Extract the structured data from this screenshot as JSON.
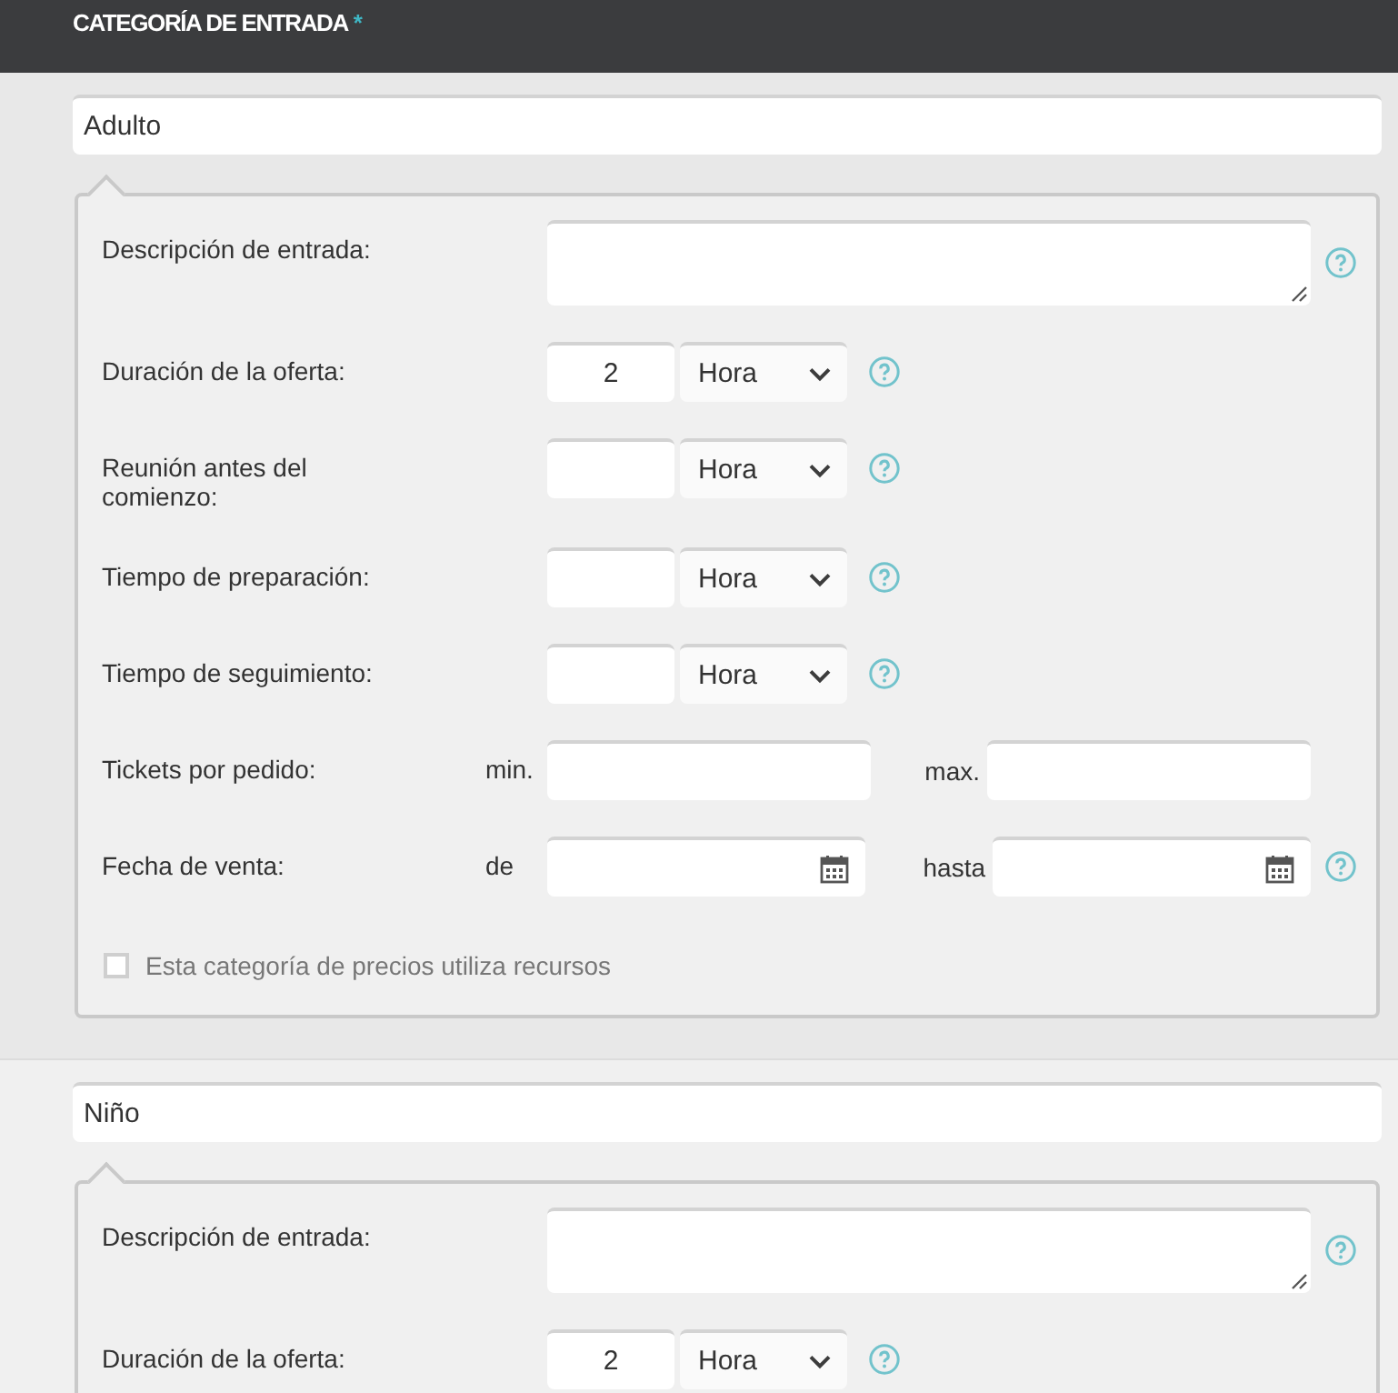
{
  "header": {
    "title": "CATEGORÍA DE ENTRADA",
    "required_mark": "*"
  },
  "categories": [
    {
      "name": "Adulto",
      "fields": [
        {
          "kind": "textarea",
          "label": "Descripción de entrada:",
          "help": true
        },
        {
          "kind": "duration",
          "label": "Duración de la oferta:",
          "value": "2",
          "unit": "Hora",
          "help": true
        },
        {
          "kind": "duration",
          "label": "Reunión antes del comienzo:",
          "unit": "Hora",
          "help": true
        },
        {
          "kind": "duration",
          "label": "Tiempo de preparación:",
          "unit": "Hora",
          "help": true
        },
        {
          "kind": "duration",
          "label": "Tiempo de seguimiento:",
          "unit": "Hora",
          "help": true
        },
        {
          "kind": "range",
          "label": "Tickets por pedido:",
          "from_label": "min.",
          "to_label": "max.",
          "help": false
        },
        {
          "kind": "date_range",
          "label": "Fecha de venta:",
          "from_label": "de",
          "to_label": "hasta",
          "help": true
        },
        {
          "kind": "checkbox",
          "label": "Esta categoría de precios utiliza recursos",
          "checked": false
        }
      ]
    },
    {
      "name": "Niño",
      "fields": [
        {
          "kind": "textarea",
          "label": "Descripción de entrada:",
          "help": true
        },
        {
          "kind": "duration",
          "label": "Duración de la oferta:",
          "value": "2",
          "unit": "Hora",
          "help": true
        }
      ]
    }
  ]
}
